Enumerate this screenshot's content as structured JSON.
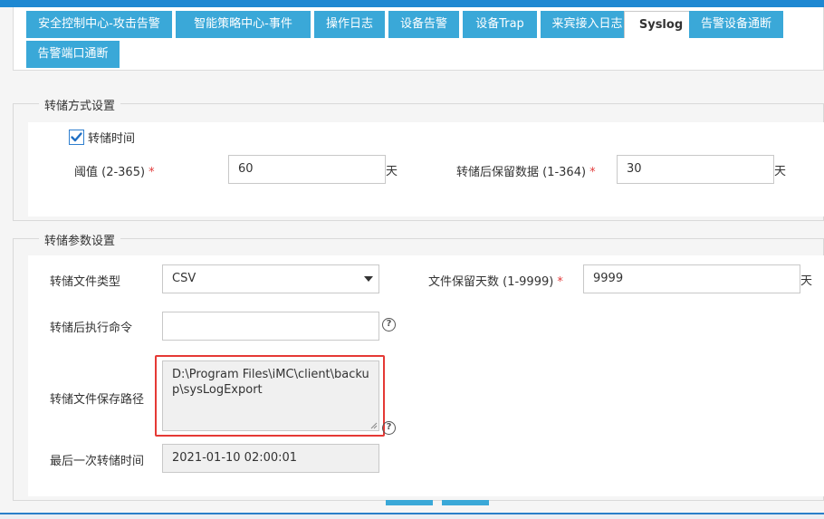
{
  "tabs": [
    {
      "label": "安全控制中心-攻击告警",
      "active": false
    },
    {
      "label": "智能策略中心-事件",
      "active": false
    },
    {
      "label": "操作日志",
      "active": false
    },
    {
      "label": "设备告警",
      "active": false
    },
    {
      "label": "设备Trap",
      "active": false
    },
    {
      "label": "来宾接入日志",
      "active": false
    },
    {
      "label": "Syslog",
      "active": true
    },
    {
      "label": "告警设备通断",
      "active": false
    },
    {
      "label": "告警端口通断",
      "active": false
    }
  ],
  "dump_method": {
    "title": "转储方式设置",
    "dump_time_label": "转储时间",
    "dump_time_checked": true,
    "threshold_label": "阈值 (2-365)",
    "threshold_value": "60",
    "threshold_unit": "天",
    "retain_label": "转储后保留数据 (1-364)",
    "retain_value": "30",
    "retain_unit": "天",
    "required_mark": "*"
  },
  "dump_params": {
    "title": "转储参数设置",
    "file_type_label": "转储文件类型",
    "file_type_value": "CSV",
    "file_keep_days_label": "文件保留天数 (1-9999)",
    "file_keep_days_value": "9999",
    "file_keep_days_unit": "天",
    "post_command_label": "转储后执行命令",
    "post_command_value": "",
    "save_path_label": "转储文件保存路径",
    "save_path_value": "D:\\Program Files\\iMC\\client\\backup\\sysLogExport",
    "last_dump_label": "最后一次转储时间",
    "last_dump_value": "2021-01-10 02:00:01",
    "help_glyph": "?",
    "required_mark": "*"
  },
  "colors": {
    "tab_bg": "#3aa8d8",
    "accent_bar": "#1e88d2",
    "highlight_border": "#e53935",
    "required": "#e23c3c",
    "checkbox": "#2f7fcf"
  }
}
